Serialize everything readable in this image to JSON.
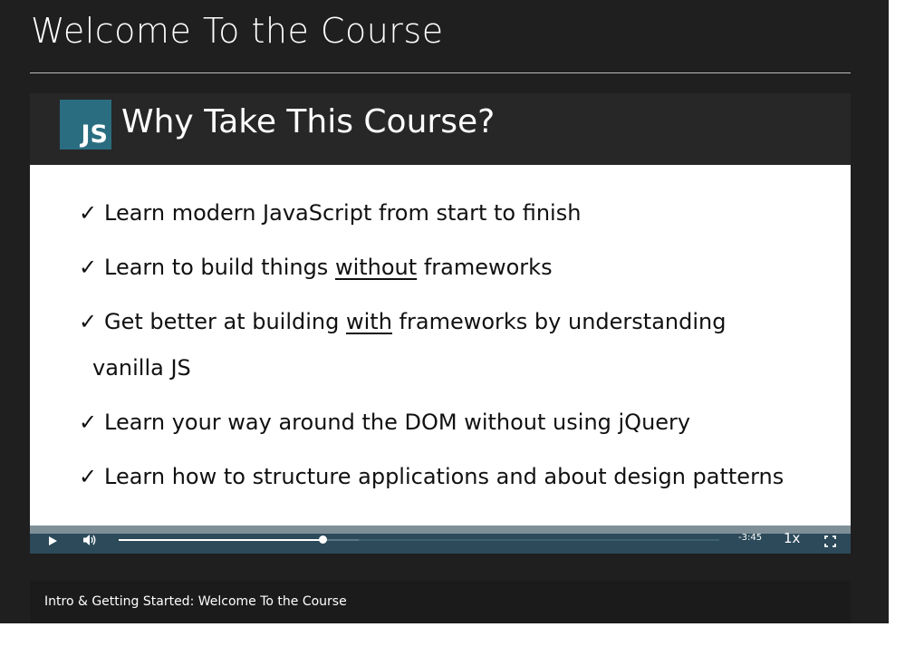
{
  "page": {
    "title": "Welcome To the Course"
  },
  "slide": {
    "logo_text": "JS",
    "title": "Why Take This Course?",
    "check_symbol": "✓",
    "bullets": [
      {
        "before": "Learn modern JavaScript from start to finish",
        "underline": "",
        "after": ""
      },
      {
        "before": "Learn to build things ",
        "underline": "without",
        "after": " frameworks"
      },
      {
        "before": "Get better at building ",
        "underline": "with",
        "after": " frameworks by understanding"
      },
      {
        "before": "Learn your way around the DOM without using jQuery",
        "underline": "",
        "after": ""
      },
      {
        "before": "Learn how to structure applications and about design patterns",
        "underline": "",
        "after": ""
      }
    ],
    "bullet3_continuation": "vanilla JS"
  },
  "player": {
    "play_icon": "play-icon",
    "volume_icon": "volume-icon",
    "fullscreen_icon": "fullscreen-icon",
    "progress_fraction": 0.34,
    "time_remaining": "-3:45",
    "speed": "1x"
  },
  "caption": {
    "text": "Intro & Getting Started: Welcome To the Course"
  },
  "colors": {
    "page_bg": "#1f1f1f",
    "slide_header_bg": "#272727",
    "js_logo_bg": "#2a6d80",
    "controls_bg": "#2c4a5a"
  }
}
